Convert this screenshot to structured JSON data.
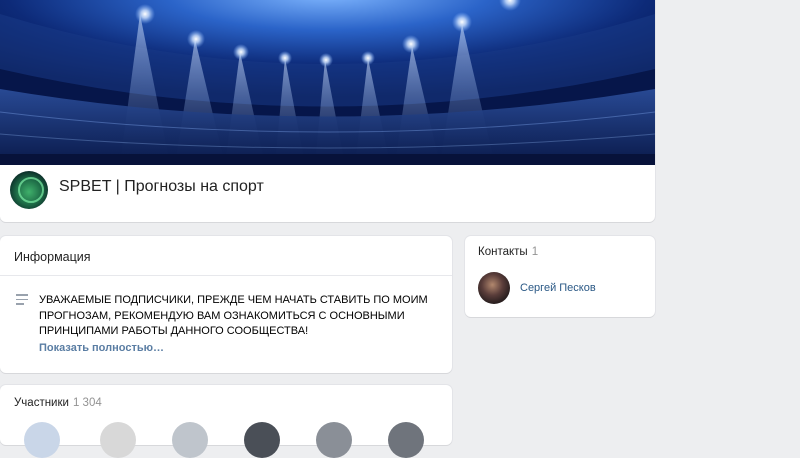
{
  "group": {
    "name": "SPBET | Прогнозы на спорт"
  },
  "info": {
    "title": "Информация",
    "text": "УВАЖАЕМЫЕ ПОДПИСЧИКИ, ПРЕЖДЕ ЧЕМ НАЧАТЬ СТАВИТЬ ПО МОИМ ПРОГНОЗАМ, РЕКОМЕНДУЮ ВАМ ОЗНАКОМИТЬСЯ С ОСНОВНЫМИ ПРИНЦИПАМИ РАБОТЫ ДАННОГО СООБЩЕСТВА!",
    "show_more": "Показать полностью…"
  },
  "contacts": {
    "title": "Контакты",
    "count": "1",
    "items": [
      {
        "name": "Сергей Песков"
      }
    ]
  },
  "members": {
    "title": "Участники",
    "count": "1 304"
  }
}
